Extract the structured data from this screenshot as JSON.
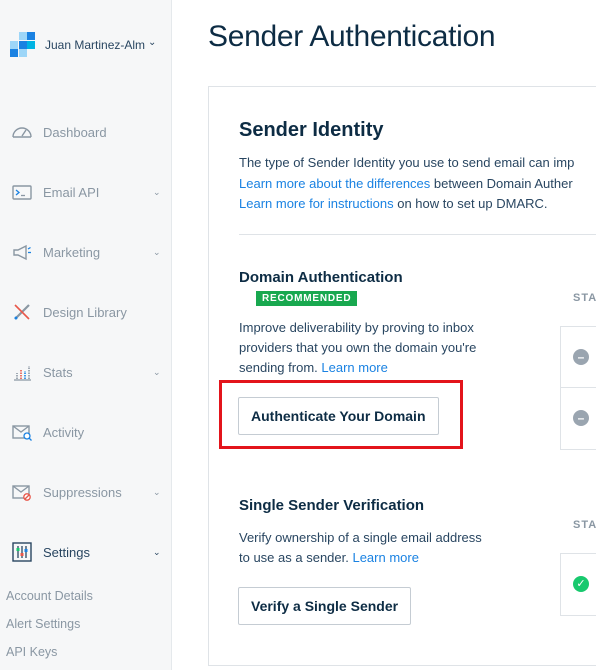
{
  "account": {
    "name": "Juan Martinez-Almaraz",
    "chevron": "⌄"
  },
  "nav": [
    {
      "label": "Dashboard",
      "icon": "gauge-icon",
      "has_chevron": false
    },
    {
      "label": "Email API",
      "icon": "terminal-icon",
      "has_chevron": true
    },
    {
      "label": "Marketing",
      "icon": "megaphone-icon",
      "has_chevron": true
    },
    {
      "label": "Design Library",
      "icon": "design-tools-icon",
      "has_chevron": false
    },
    {
      "label": "Stats",
      "icon": "bar-chart-icon",
      "has_chevron": true
    },
    {
      "label": "Activity",
      "icon": "envelope-search-icon",
      "has_chevron": false
    },
    {
      "label": "Suppressions",
      "icon": "envelope-block-icon",
      "has_chevron": true
    },
    {
      "label": "Settings",
      "icon": "sliders-icon",
      "has_chevron": true,
      "active": true
    }
  ],
  "settings_sub": [
    "Account Details",
    "Alert Settings",
    "API Keys"
  ],
  "page": {
    "title": "Sender Authentication",
    "section_title": "Sender Identity",
    "intro_line1": "The type of Sender Identity you use to send email can imp",
    "intro_line2_link": "Learn more about the differences",
    "intro_line2_rest": " between Domain Auther",
    "intro_line3_link": "Learn more for instructions",
    "intro_line3_rest": " on how to set up DMARC."
  },
  "domain_auth": {
    "title": "Domain Authentication",
    "badge": "RECOMMENDED",
    "desc_line1": "Improve deliverability by proving to inbox",
    "desc_line2": "providers that you own the domain you're",
    "desc_line3": "sending from. ",
    "desc_link": "Learn more",
    "button": "Authenticate Your Domain",
    "status_header": "STA",
    "statuses": [
      "minus",
      "minus"
    ]
  },
  "single_sender": {
    "title": "Single Sender Verification",
    "desc_line1": "Verify ownership of a single email address",
    "desc_line2": "to use as a sender. ",
    "desc_link": "Learn more",
    "button": "Verify a Single Sender",
    "status_header": "STA",
    "statuses": [
      "check"
    ]
  },
  "colors": {
    "accent_link": "#1a82e2",
    "badge_green": "#18a84f",
    "highlight_red": "#e3141b"
  }
}
